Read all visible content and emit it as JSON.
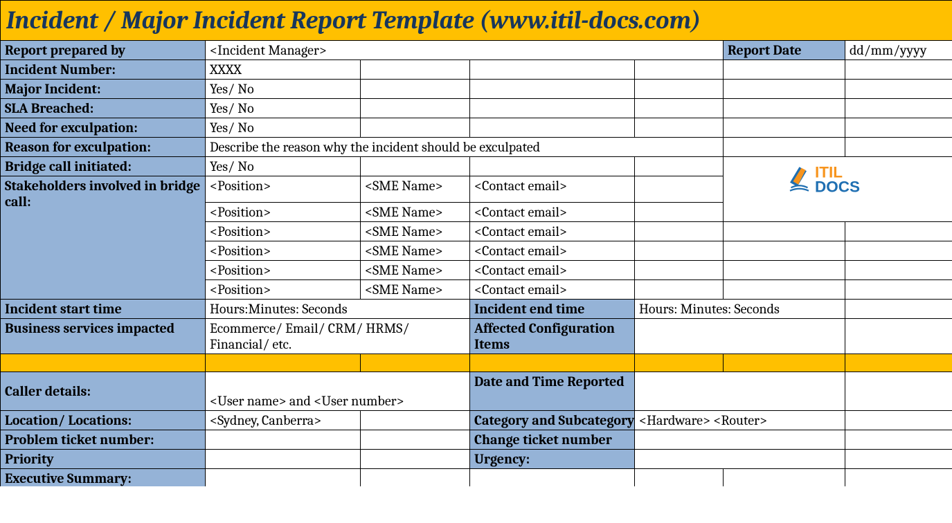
{
  "title": "Incident / Major Incident Report Template   (www.itil-docs.com)",
  "labels": {
    "report_prepared_by": "Report prepared by",
    "report_date": "Report Date",
    "incident_number": "Incident Number:",
    "major_incident": "Major Incident:",
    "sla_breached": "SLA Breached:",
    "need_exculpation": "Need for exculpation:",
    "reason_exculpation": "Reason for exculpation:",
    "bridge_call": "Bridge call initiated:",
    "stakeholders": "Stakeholders involved in bridge call:",
    "incident_start": "Incident start time",
    "incident_end": "Incident end time",
    "business_services": "Business services impacted",
    "affected_ci": "Affected Configuration Items",
    "caller_details": "Caller details:",
    "date_time_reported": "Date and Time Reported",
    "location": "Location/ Locations:",
    "category_subcat": "Category and Subcategory",
    "problem_ticket": "Problem ticket number:",
    "change_ticket": "Change ticket number",
    "priority": "Priority",
    "urgency": "Urgency:",
    "exec_summary": "Executive Summary:"
  },
  "values": {
    "report_prepared_by": "<Incident Manager>",
    "report_date": "dd/mm/yyyy",
    "incident_number": "XXXX",
    "major_incident": "Yes/ No",
    "sla_breached": "Yes/ No",
    "need_exculpation": "Yes/ No",
    "reason_exculpation": "Describe the reason why the incident should be exculpated",
    "bridge_call": "Yes/ No",
    "incident_start": "Hours:Minutes: Seconds",
    "incident_end": "Hours: Minutes: Seconds",
    "business_services": "Ecommerce/ Email/ CRM/ HRMS/ Financial/ etc.",
    "caller_details": "<User name> and <User number>",
    "location": "<Sydney, Canberra>",
    "category_subcat": "<Hardware> <Router>"
  },
  "stakeholder_cols": {
    "position": "<Position>",
    "sme": "<SME Name>",
    "email": "<Contact email>"
  },
  "logo": {
    "text1": "ITIL",
    "text2": "DOCS"
  }
}
